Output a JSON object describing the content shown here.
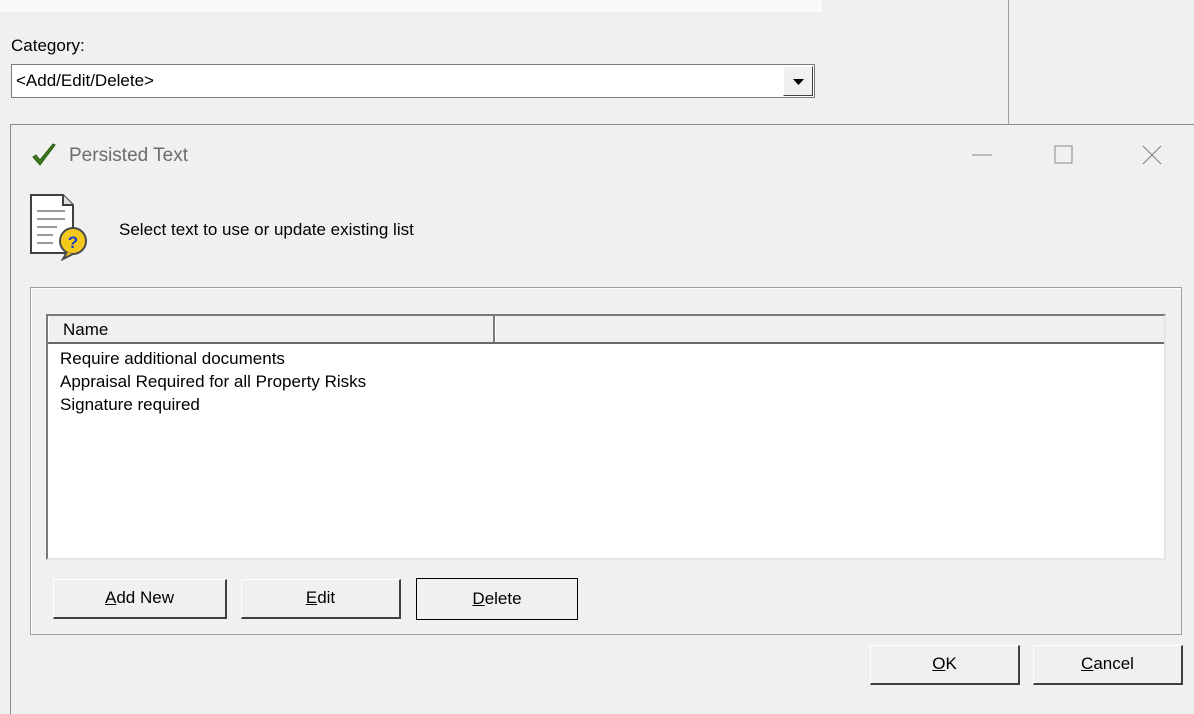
{
  "background": {
    "category_label": "Category:",
    "category_value": "<Add/Edit/Delete>"
  },
  "dialog": {
    "title": "Persisted Text",
    "instruction": "Select text to use or update existing list",
    "list": {
      "columns": [
        "Name",
        ""
      ],
      "items": [
        "Require additional documents",
        "Appraisal Required for all Property Risks",
        "Signature required"
      ]
    },
    "buttons": {
      "add_new": {
        "mnemonic": "A",
        "rest": "dd New"
      },
      "edit": {
        "mnemonic": "E",
        "rest": "dit"
      },
      "delete": {
        "mnemonic": "D",
        "rest": "elete"
      },
      "ok": {
        "mnemonic": "O",
        "rest": "K"
      },
      "cancel": {
        "mnemonic": "C",
        "rest": "ancel"
      }
    }
  },
  "icons": {
    "title_icon": "checkmark-icon",
    "info_icon": "document-question-icon",
    "minimize": "minimize-icon",
    "maximize": "maximize-icon",
    "close": "close-icon",
    "dropdown": "chevron-down-icon"
  },
  "colors": {
    "title_check": "#3c7a1e",
    "title_text": "#6d6d6d",
    "question_badge": "#f2c81b"
  }
}
